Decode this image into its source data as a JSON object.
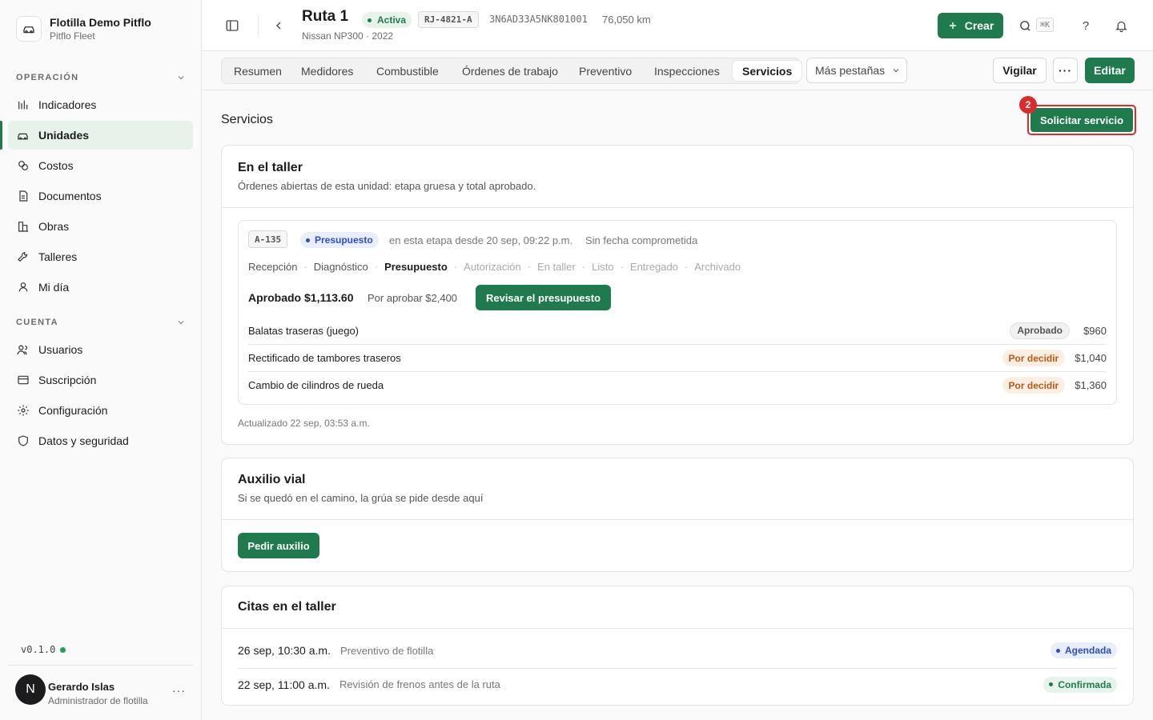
{
  "org": {
    "name": "Flotilla Demo Pitflo",
    "sub": "Pitflo Fleet"
  },
  "sidebar": {
    "section_operation": "OPERACIÓN",
    "section_account": "CUENTA",
    "operation_items": [
      {
        "label": "Indicadores",
        "icon": "chart-bars-icon"
      },
      {
        "label": "Unidades",
        "icon": "car-icon",
        "active": true
      },
      {
        "label": "Costos",
        "icon": "coins-icon"
      },
      {
        "label": "Documentos",
        "icon": "document-icon"
      },
      {
        "label": "Obras",
        "icon": "buildings-icon"
      },
      {
        "label": "Talleres",
        "icon": "wrench-icon"
      },
      {
        "label": "Mi día",
        "icon": "person-icon"
      }
    ],
    "account_items": [
      {
        "label": "Usuarios",
        "icon": "users-icon"
      },
      {
        "label": "Suscripción",
        "icon": "credit-card-icon"
      },
      {
        "label": "Configuración",
        "icon": "gear-icon"
      },
      {
        "label": "Datos y seguridad",
        "icon": "shield-icon"
      }
    ],
    "version": "v0.1.0",
    "user": {
      "initial": "N",
      "name": "Gerardo Islas",
      "role": "Administrador de flotilla",
      "more": "···"
    }
  },
  "header": {
    "title": "Ruta 1",
    "status": "Activa",
    "plate": "RJ-4821-A",
    "vin": "3N6AD33A5NK801001",
    "km": "76,050 km",
    "subtitle": "Nissan NP300 · 2022",
    "create_label": "Crear",
    "search_shortcut": "⌘K"
  },
  "tabs": {
    "items": [
      "Resumen",
      "Medidores",
      "Combustible",
      "Órdenes de trabajo",
      "Preventivo",
      "Inspecciones",
      "Servicios"
    ],
    "active": "Servicios",
    "more_label": "Más pestañas",
    "watch_label": "Vigilar",
    "edit_label": "Editar"
  },
  "page": {
    "title": "Servicios",
    "request_label": "Solicitar servicio",
    "marker": "2"
  },
  "workshop": {
    "title": "En el taller",
    "description": "Órdenes abiertas de esta unidad: etapa gruesa y total aprobado.",
    "order": {
      "code": "A-135",
      "stage_badge": "Presupuesto",
      "since": "en esta etapa desde 20 sep, 09:22 p.m.",
      "commit": "Sin fecha comprometida",
      "steps": [
        {
          "label": "Recepción",
          "state": "done"
        },
        {
          "label": "Diagnóstico",
          "state": "done"
        },
        {
          "label": "Presupuesto",
          "state": "current"
        },
        {
          "label": "Autorización",
          "state": "future"
        },
        {
          "label": "En taller",
          "state": "future"
        },
        {
          "label": "Listo",
          "state": "future"
        },
        {
          "label": "Entregado",
          "state": "future"
        },
        {
          "label": "Archivado",
          "state": "future"
        }
      ],
      "approved": "Aprobado $1,113.60",
      "pending": "Por aprobar $2,400",
      "review_label": "Revisar el presupuesto",
      "lines": [
        {
          "name": "Balatas traseras (juego)",
          "status": "Aprobado",
          "kind": "approved",
          "price": "$960"
        },
        {
          "name": "Rectificado de tambores traseros",
          "status": "Por decidir",
          "kind": "pending",
          "price": "$1,040"
        },
        {
          "name": "Cambio de cilindros de rueda",
          "status": "Por decidir",
          "kind": "pending",
          "price": "$1,360"
        }
      ]
    },
    "updated": "Actualizado 22 sep, 03:53 a.m."
  },
  "roadside": {
    "title": "Auxilio vial",
    "description": "Si se quedó en el camino, la grúa se pide desde aquí",
    "button": "Pedir auxilio"
  },
  "appointments": {
    "title": "Citas en el taller",
    "items": [
      {
        "date": "26 sep, 10:30 a.m.",
        "desc": "Preventivo de flotilla",
        "status": "Agendada",
        "kind": "blue"
      },
      {
        "date": "22 sep, 11:00 a.m.",
        "desc": "Revisión de frenos antes de la ruta",
        "status": "Confirmada",
        "kind": "green"
      }
    ]
  },
  "colors": {
    "brand": "#1f7a4d",
    "highlight": "#d92d2d",
    "blue": "#2c4fc0",
    "orange": "#b85a17"
  }
}
